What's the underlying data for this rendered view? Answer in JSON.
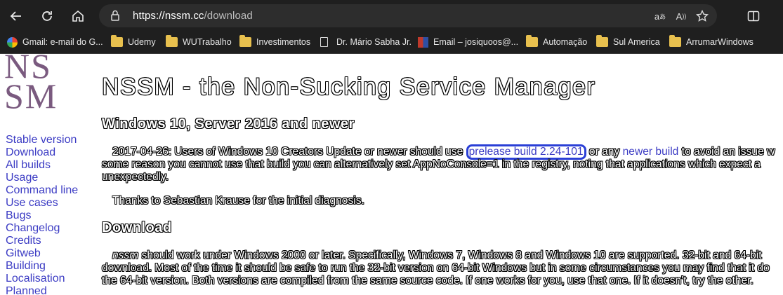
{
  "browser": {
    "url_prefix": "https://nssm.cc",
    "url_path": "/download",
    "icons": [
      "back-icon",
      "refresh-icon",
      "home-icon",
      "lock-icon",
      "read-aloud-icon",
      "favorite-icon",
      "split-screen-icon"
    ]
  },
  "bookmarks": [
    {
      "label": "Gmail: e-mail do G...",
      "icon": "google-icon"
    },
    {
      "label": "Udemy",
      "icon": "folder-icon"
    },
    {
      "label": "WUTrabalho",
      "icon": "folder-icon"
    },
    {
      "label": "Investimentos",
      "icon": "folder-icon"
    },
    {
      "label": "Dr. Mário Sabha Jr.",
      "icon": "page-icon"
    },
    {
      "label": "Email – josiquoos@...",
      "icon": "email-icon"
    },
    {
      "label": "Automação",
      "icon": "folder-icon"
    },
    {
      "label": "Sul America",
      "icon": "folder-icon"
    },
    {
      "label": "ArrumarWindows",
      "icon": "folder-icon"
    }
  ],
  "logo": {
    "line1": "NS",
    "line2": "SM"
  },
  "sidebar": [
    "Stable version",
    "Download",
    "All builds",
    "Usage",
    "Command line",
    "Use cases",
    "Bugs",
    "Changelog",
    "Credits",
    "Gitweb",
    "Building",
    "Localisation",
    "Planned"
  ],
  "main": {
    "title": "NSSM - the Non-Sucking Service Manager",
    "section1_heading": "Windows 10, Server 2016 and newer",
    "p1_line1_a": "2017-04-26: Users of Windows 10 Creators Update or newer should use ",
    "p1_link1": "prelease build 2.24-101",
    "p1_line1_b": " or any ",
    "p1_link2": "newer build",
    "p1_line1_c": " to avoid an issue w",
    "p1_line2": "some reason you cannot use that build you can alternatively set AppNoConsole=1 in the registry, noting that applications which expect a",
    "p1_line3": "unexpectedly.",
    "p2": "Thanks to Sebastian Krause for the initial diagnosis.",
    "section2_heading": "Download",
    "p3_em": "nssm",
    "p3_line1": " should work under Windows 2000 or later. Specifically, Windows 7, Windows 8 and Windows 10 are supported. 32-bit and 64-bit",
    "p3_line2": "download. Most of the time it should be safe to run the 32-bit version on 64-bit Windows but in some circumstances you may find that it do",
    "p3_line3": "the 64-bit version. Both versions are compiled from the same source code. If one works for you, use that one. If it doesn't, try the other."
  }
}
